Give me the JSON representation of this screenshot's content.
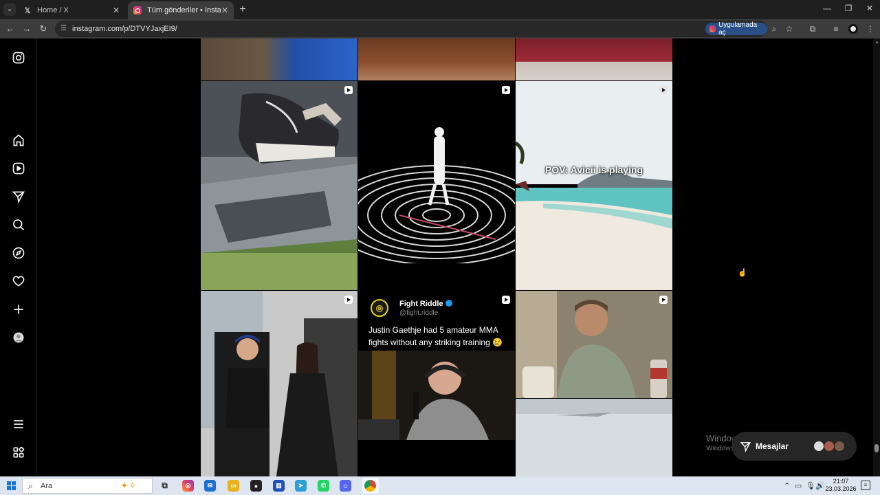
{
  "browser": {
    "tabs": [
      {
        "title": "Home / X",
        "favicon": "x-logo-icon"
      },
      {
        "title": "Tüm gönderiler • Instagram",
        "favicon": "instagram-icon",
        "active": true
      }
    ],
    "url": "instagram.com/p/DTVYJaxjEI9/",
    "open_in_app_label": "Uygulamada aç"
  },
  "sidebar": {
    "items": [
      {
        "name": "instagram-logo-icon"
      },
      {
        "name": "home-icon"
      },
      {
        "name": "reels-icon"
      },
      {
        "name": "messages-icon"
      },
      {
        "name": "search-icon"
      },
      {
        "name": "explore-icon"
      },
      {
        "name": "notifications-icon"
      },
      {
        "name": "create-icon"
      },
      {
        "name": "profile-avatar"
      },
      {
        "name": "more-menu-icon"
      },
      {
        "name": "also-from-meta-icon"
      }
    ]
  },
  "posts": {
    "beach_caption": "POV: Avicii is playing",
    "tweet": {
      "name": "Fight Riddle",
      "handle": "@fight.riddle",
      "text": "Justin Gaethje had 5 amateur MMA fights without any striking training 😢"
    }
  },
  "activation_watermark": {
    "title": "Windows'u Etkinleştir",
    "subtitle": "Windows'u etkinleştirmek için Ayarlar'a gidin."
  },
  "messages_button": {
    "label": "Mesajlar"
  },
  "taskbar": {
    "search_placeholder": "Ara",
    "time": "21:07",
    "date": "23.03.2026"
  }
}
